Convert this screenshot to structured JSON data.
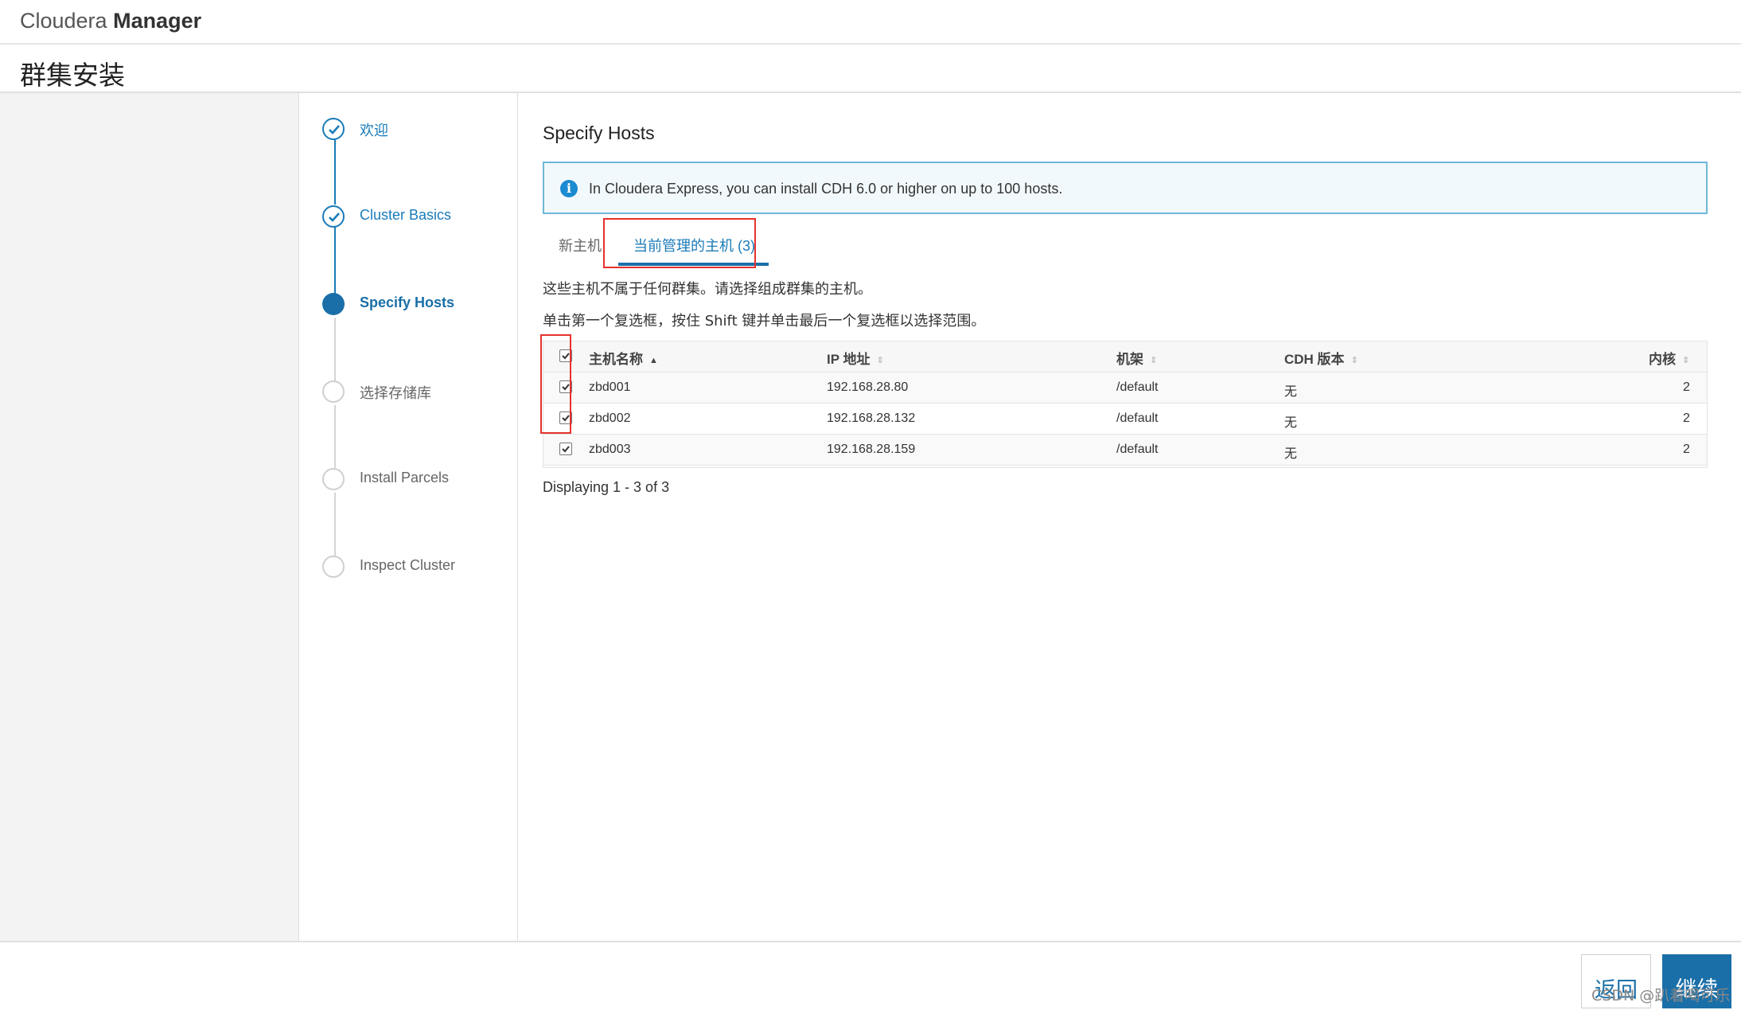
{
  "header": {
    "brand_light": "Cloudera ",
    "brand_bold": "Manager",
    "page_title": "群集安装"
  },
  "steps": [
    {
      "label": "欢迎",
      "status": "done"
    },
    {
      "label": "Cluster Basics",
      "status": "done"
    },
    {
      "label": "Specify Hosts",
      "status": "active"
    },
    {
      "label": "选择存储库",
      "status": "todo"
    },
    {
      "label": "Install Parcels",
      "status": "todo"
    },
    {
      "label": "Inspect Cluster",
      "status": "todo"
    }
  ],
  "main": {
    "title": "Specify Hosts",
    "info_text": "In Cloudera Express, you can install CDH 6.0 or higher on up to 100 hosts.",
    "tabs": [
      {
        "label": "新主机",
        "active": false
      },
      {
        "label": "当前管理的主机 (3)",
        "active": true
      }
    ],
    "hint1": "这些主机不属于任何群集。请选择组成群集的主机。",
    "hint2": "单击第一个复选框，按住 Shift 键并单击最后一个复选框以选择范围。",
    "table": {
      "columns": [
        "主机名称",
        "IP 地址",
        "机架",
        "CDH 版本",
        "内核"
      ],
      "rows": [
        {
          "checked": true,
          "host": "zbd001",
          "ip": "192.168.28.80",
          "rack": "/default",
          "cdh": "无",
          "cores": "2"
        },
        {
          "checked": true,
          "host": "zbd002",
          "ip": "192.168.28.132",
          "rack": "/default",
          "cdh": "无",
          "cores": "2"
        },
        {
          "checked": true,
          "host": "zbd003",
          "ip": "192.168.28.159",
          "rack": "/default",
          "cdh": "无",
          "cores": "2"
        }
      ]
    },
    "displaying": "Displaying 1 - 3 of 3"
  },
  "footer": {
    "back_label": "返回",
    "continue_label": "继续"
  },
  "watermark": "CSDN @趴着喝可乐",
  "colors": {
    "accent": "#1a6fa8",
    "highlight_box": "#e5322d",
    "info_border": "#6fb8d9"
  }
}
